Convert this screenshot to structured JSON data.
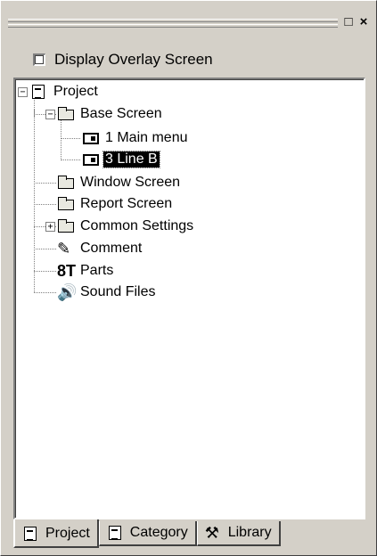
{
  "window": {
    "minimize_glyph": "□",
    "close_glyph": "×"
  },
  "overlay": {
    "label": "Display Overlay Screen",
    "checked": false
  },
  "tree": {
    "root": {
      "label": "Project",
      "icon": "project-icon",
      "expander": "−"
    },
    "base_screen": {
      "label": "Base Screen",
      "icon": "folder-icon",
      "expander": "−"
    },
    "main_menu": {
      "label": "1 Main menu",
      "icon": "screen-icon"
    },
    "line_b": {
      "label": "3 Line B",
      "icon": "screen-icon",
      "selected": true
    },
    "window_screen": {
      "label": "Window Screen",
      "icon": "folder-icon"
    },
    "report_screen": {
      "label": "Report Screen",
      "icon": "folder-icon"
    },
    "common_settings": {
      "label": "Common Settings",
      "icon": "folder-icon",
      "expander": "+"
    },
    "comment": {
      "label": "Comment",
      "icon": "pen-icon"
    },
    "parts": {
      "label": "Parts",
      "icon": "parts-icon"
    },
    "sound_files": {
      "label": "Sound Files",
      "icon": "speaker-icon"
    }
  },
  "tabs": [
    {
      "label": "Project",
      "icon": "project-icon",
      "active": true
    },
    {
      "label": "Category",
      "icon": "document-icon",
      "active": false
    },
    {
      "label": "Library",
      "icon": "tools-icon",
      "active": false
    }
  ]
}
